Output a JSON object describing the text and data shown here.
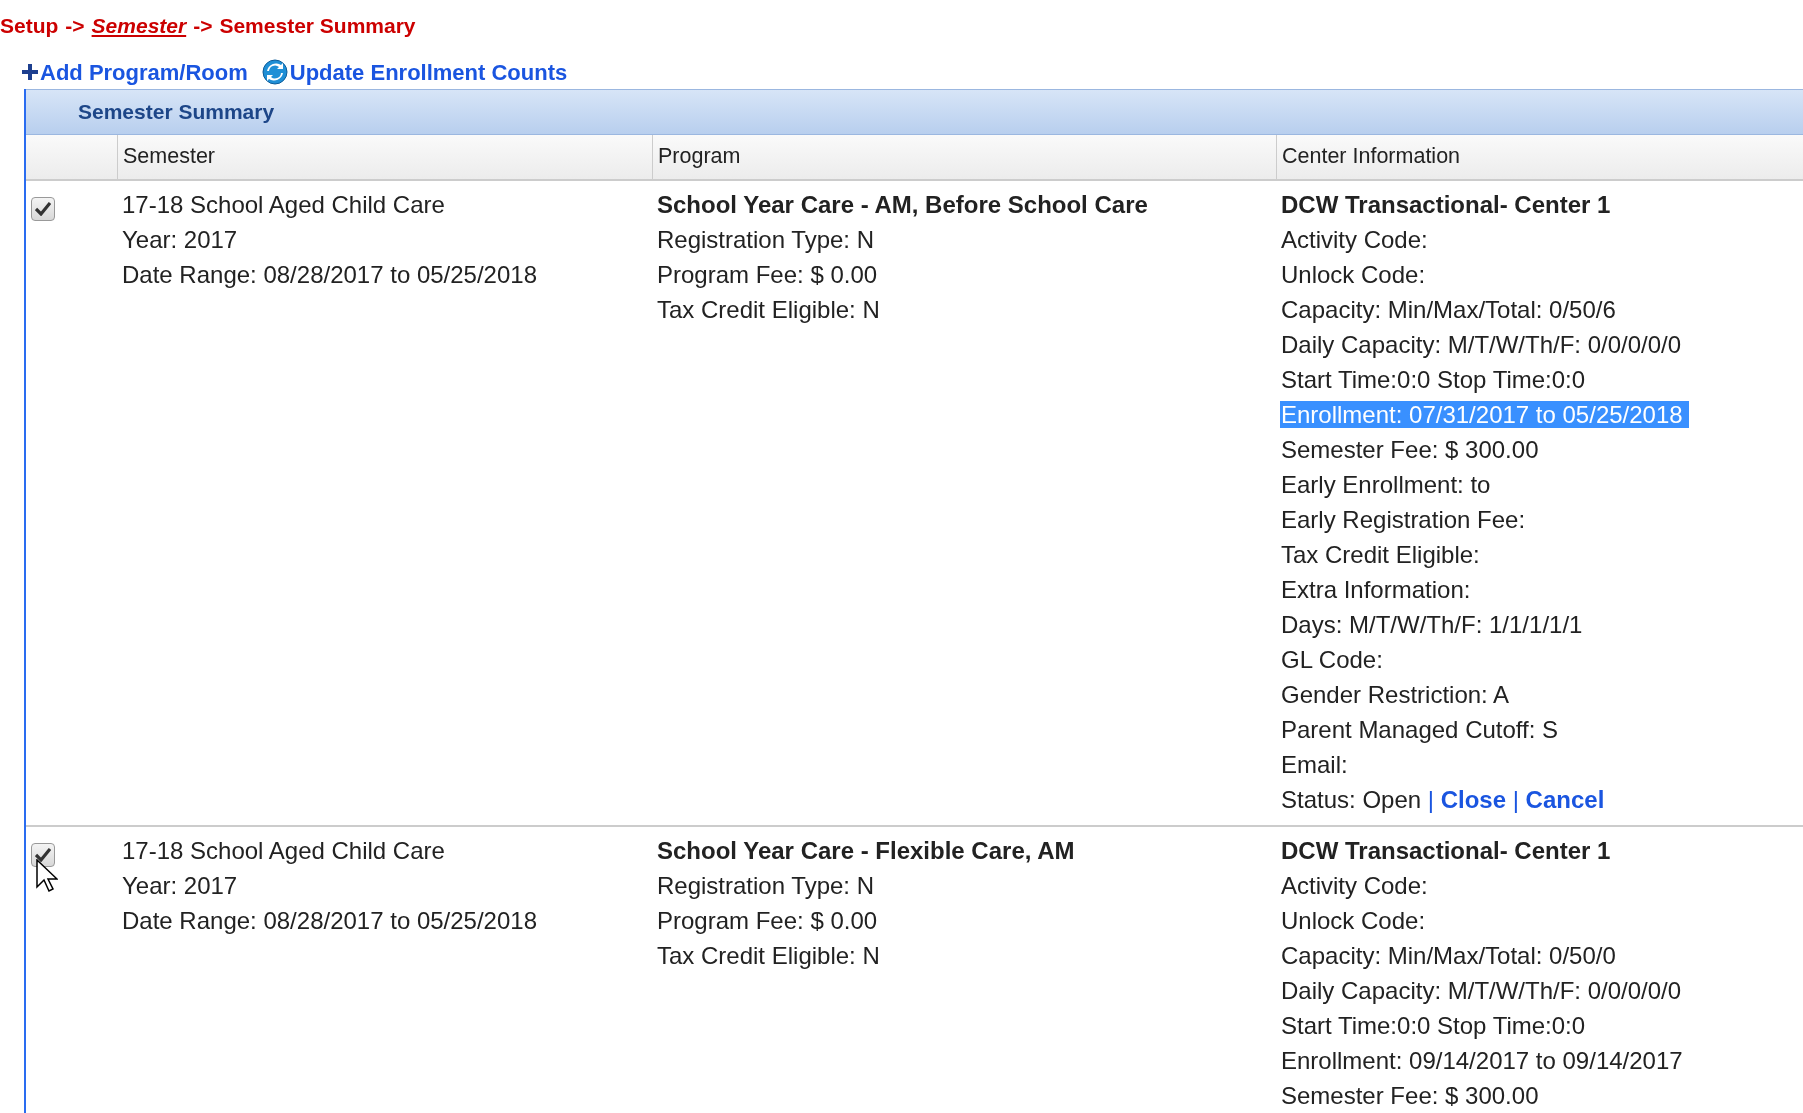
{
  "breadcrumb": [
    {
      "label": "Setup",
      "link": false
    },
    {
      "label": "->",
      "link": false
    },
    {
      "label": "Semester",
      "link": true
    },
    {
      "label": "->",
      "link": false
    },
    {
      "label": "Semester Summary",
      "link": false
    }
  ],
  "actions": [
    {
      "label": "Add Program/Room",
      "kind": "add"
    },
    {
      "label": "Update Enrollment Counts",
      "kind": "refresh"
    }
  ],
  "panel": {
    "title": "Semester Summary"
  },
  "table": {
    "columns": [
      "Semester",
      "Program",
      "Center Information"
    ],
    "rows": [
      {
        "checked": true,
        "semester": [
          "17-18 School Aged Child Care",
          "Year: 2017",
          "Date Range: 08/28/2017 to 05/25/2018"
        ],
        "program": {
          "title": "School Year Care - AM, Before School Care",
          "lines": [
            "Registration Type: N",
            "Program Fee: $ 0.00",
            "Tax Credit Eligible: N"
          ]
        },
        "center": {
          "title": "DCW Transactional- Center 1",
          "lines": [
            {
              "kind": "text",
              "text": "Activity Code:",
              "highlighted": false
            },
            {
              "kind": "text",
              "text": "Unlock Code:",
              "highlighted": false
            },
            {
              "kind": "text",
              "text": "Capacity: Min/Max/Total: 0/50/6",
              "highlighted": false
            },
            {
              "kind": "text",
              "text": "Daily Capacity: M/T/W/Th/F: 0/0/0/0/0",
              "highlighted": false
            },
            {
              "kind": "text",
              "text": "Start Time:0:0 Stop Time:0:0",
              "highlighted": false
            },
            {
              "kind": "text",
              "text": "Enrollment: 07/31/2017 to 05/25/2018",
              "highlighted": true
            },
            {
              "kind": "text",
              "text": "Semester Fee: $ 300.00",
              "highlighted": false
            },
            {
              "kind": "text",
              "text": "Early Enrollment: to",
              "highlighted": false
            },
            {
              "kind": "text",
              "text": "Early Registration Fee:",
              "highlighted": false
            },
            {
              "kind": "text",
              "text": "Tax Credit Eligible:",
              "highlighted": false
            },
            {
              "kind": "text",
              "text": "Extra Information:",
              "highlighted": false
            },
            {
              "kind": "text",
              "text": "Days: M/T/W/Th/F: 1/1/1/1/1",
              "highlighted": false
            },
            {
              "kind": "text",
              "text": "GL Code:",
              "highlighted": false
            },
            {
              "kind": "text",
              "text": "Gender Restriction: A",
              "highlighted": false
            },
            {
              "kind": "text",
              "text": "Parent Managed Cutoff: S",
              "highlighted": false
            },
            {
              "kind": "text",
              "text": "Email:",
              "highlighted": false
            },
            {
              "kind": "status",
              "text": "Status: Open",
              "links": [
                "Close",
                "Cancel"
              ],
              "separator": "|"
            }
          ]
        }
      },
      {
        "checked": true,
        "semester": [
          "17-18 School Aged Child Care",
          "Year: 2017",
          "Date Range: 08/28/2017 to 05/25/2018"
        ],
        "program": {
          "title": "School Year Care - Flexible Care, AM",
          "lines": [
            "Registration Type: N",
            "Program Fee: $ 0.00",
            "Tax Credit Eligible: N"
          ]
        },
        "center": {
          "title": "DCW Transactional- Center 1",
          "lines": [
            {
              "kind": "text",
              "text": "Activity Code:",
              "highlighted": false
            },
            {
              "kind": "text",
              "text": "Unlock Code:",
              "highlighted": false
            },
            {
              "kind": "text",
              "text": "Capacity: Min/Max/Total: 0/50/0",
              "highlighted": false
            },
            {
              "kind": "text",
              "text": "Daily Capacity: M/T/W/Th/F: 0/0/0/0/0",
              "highlighted": false
            },
            {
              "kind": "text",
              "text": "Start Time:0:0 Stop Time:0:0",
              "highlighted": false
            },
            {
              "kind": "text",
              "text": "Enrollment: 09/14/2017 to 09/14/2017",
              "highlighted": false
            },
            {
              "kind": "text",
              "text": "Semester Fee: $ 300.00",
              "highlighted": false
            }
          ]
        }
      }
    ]
  }
}
